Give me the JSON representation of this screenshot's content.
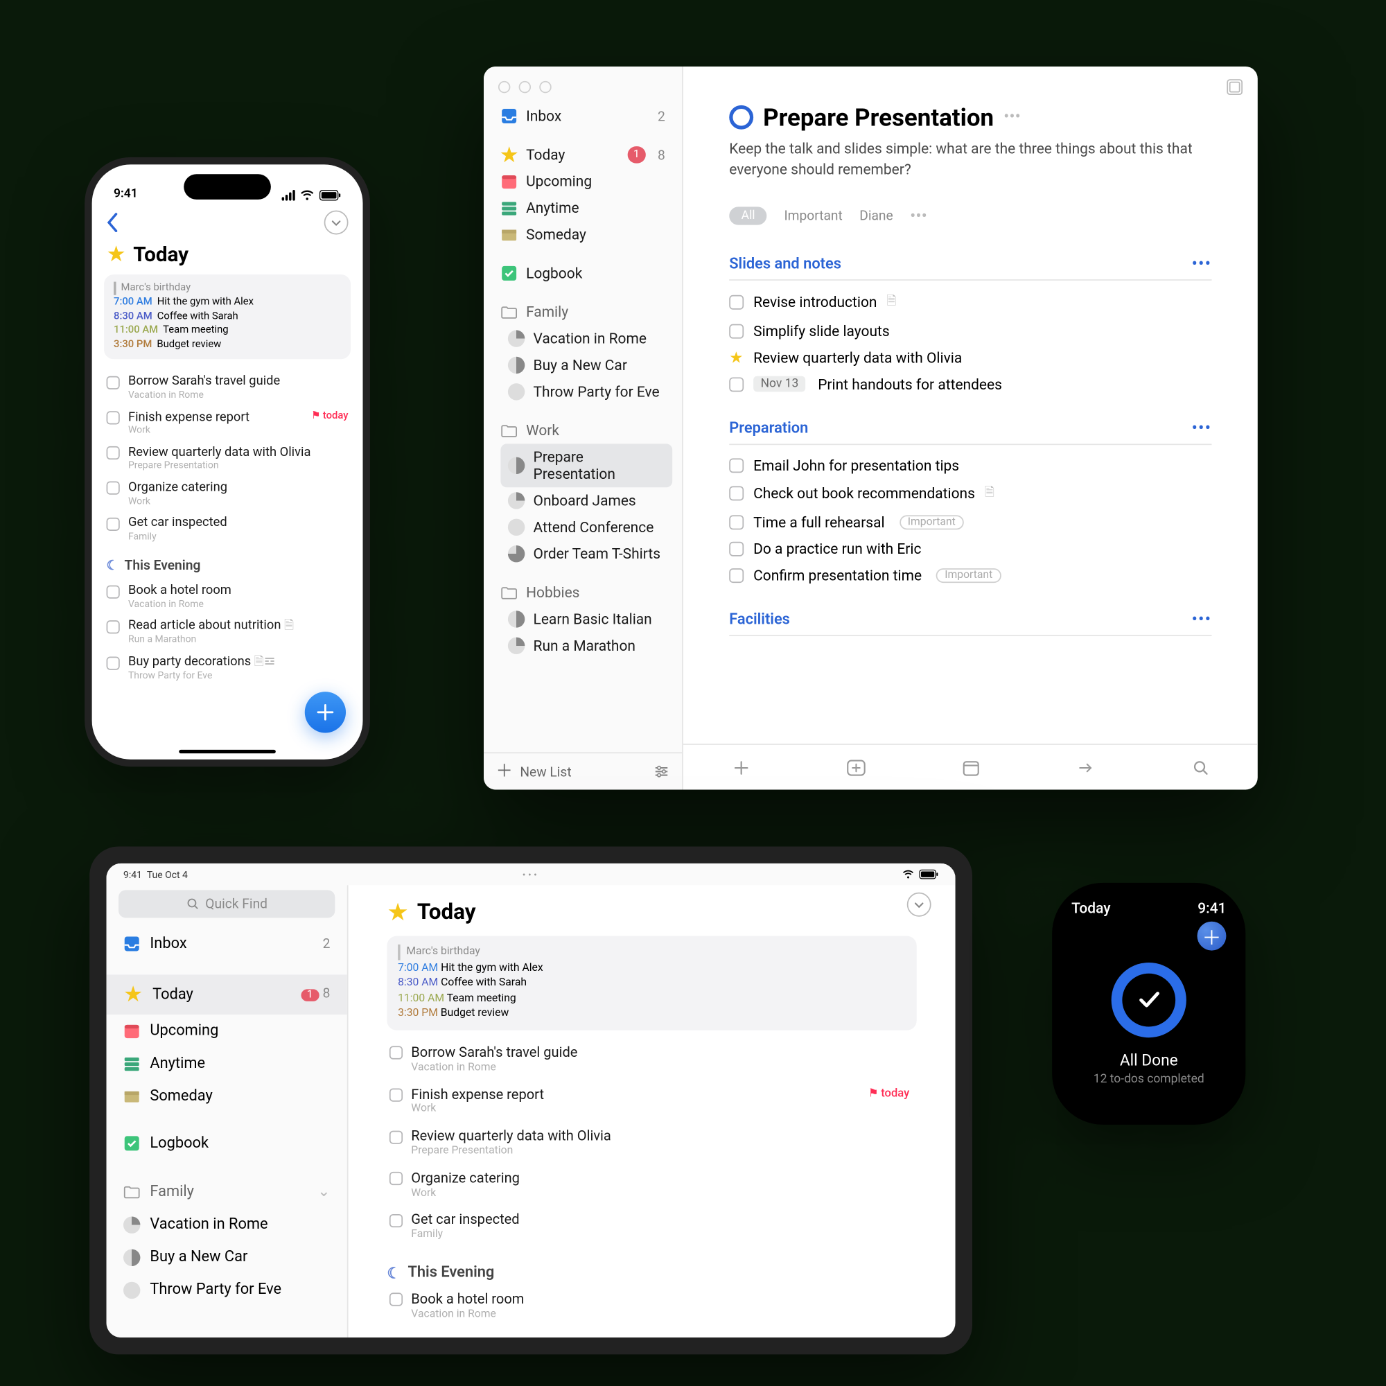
{
  "iphone": {
    "time": "9:41",
    "title": "Today",
    "events": {
      "birthday": "Marc's birthday",
      "items": [
        {
          "time": "7:00 AM",
          "text": "Hit the gym with Alex",
          "cls": "c-blue"
        },
        {
          "time": "8:30 AM",
          "text": "Coffee with Sarah",
          "cls": "c-indigo"
        },
        {
          "time": "11:00 AM",
          "text": "Team meeting",
          "cls": "c-olive"
        },
        {
          "time": "3:30 PM",
          "text": "Budget review",
          "cls": "c-brown"
        }
      ]
    },
    "tasks": [
      {
        "title": "Borrow Sarah's travel guide",
        "sub": "Vacation in Rome"
      },
      {
        "title": "Finish expense report",
        "sub": "Work",
        "flag": "today"
      },
      {
        "title": "Review quarterly data with Olivia",
        "sub": "Prepare Presentation"
      },
      {
        "title": "Organize catering",
        "sub": "Work"
      },
      {
        "title": "Get car inspected",
        "sub": "Family"
      }
    ],
    "evening_label": "This Evening",
    "evening_tasks": [
      {
        "title": "Book a hotel room",
        "sub": "Vacation in Rome"
      },
      {
        "title": "Read article about nutrition",
        "sub": "Run a Marathon",
        "note": true
      },
      {
        "title": "Buy party decorations",
        "sub": "Throw Party for Eve",
        "note": true,
        "list": true
      }
    ]
  },
  "mac": {
    "sidebar": {
      "inbox": {
        "label": "Inbox",
        "count": "2"
      },
      "today": {
        "label": "Today",
        "badge": "1",
        "count": "8"
      },
      "upcoming": {
        "label": "Upcoming"
      },
      "anytime": {
        "label": "Anytime"
      },
      "someday": {
        "label": "Someday"
      },
      "logbook": {
        "label": "Logbook"
      },
      "family": {
        "label": "Family",
        "items": [
          "Vacation in Rome",
          "Buy a New Car",
          "Throw Party for Eve"
        ]
      },
      "work": {
        "label": "Work",
        "items": [
          "Prepare Presentation",
          "Onboard James",
          "Attend Conference",
          "Order Team T-Shirts"
        ]
      },
      "hobbies": {
        "label": "Hobbies",
        "items": [
          "Learn Basic Italian",
          "Run a Marathon"
        ]
      },
      "new_list": "New List"
    },
    "main": {
      "title": "Prepare Presentation",
      "notes": "Keep the talk and slides simple: what are the three things about this that everyone should remember?",
      "tags": {
        "all": "All",
        "important": "Important",
        "diane": "Diane"
      },
      "groups": [
        {
          "name": "Slides and notes",
          "tasks": [
            {
              "t": "Revise introduction",
              "note": true
            },
            {
              "t": "Simplify slide layouts"
            },
            {
              "t": "Review quarterly data with Olivia",
              "star": true
            },
            {
              "t": "Print handouts for attendees",
              "date": "Nov 13"
            }
          ]
        },
        {
          "name": "Preparation",
          "tasks": [
            {
              "t": "Email John for presentation tips"
            },
            {
              "t": "Check out book recommendations",
              "note": true
            },
            {
              "t": "Time a full rehearsal",
              "imp": "Important"
            },
            {
              "t": "Do a practice run with Eric"
            },
            {
              "t": "Confirm presentation time",
              "imp": "Important"
            }
          ]
        },
        {
          "name": "Facilities",
          "tasks": []
        }
      ]
    }
  },
  "ipad": {
    "time": "9:41",
    "date": "Tue Oct 4",
    "quick_find": "Quick Find",
    "sidebar": {
      "inbox": {
        "label": "Inbox",
        "count": "2"
      },
      "today": {
        "label": "Today",
        "badge": "1",
        "count": "8"
      },
      "upcoming": "Upcoming",
      "anytime": "Anytime",
      "someday": "Someday",
      "logbook": "Logbook",
      "family": {
        "label": "Family",
        "items": [
          "Vacation in Rome",
          "Buy a New Car",
          "Throw Party for Eve"
        ]
      }
    },
    "title": "Today",
    "events": {
      "birthday": "Marc's birthday",
      "items": [
        {
          "time": "7:00 AM",
          "text": "Hit the gym with Alex",
          "cls": "c-blue"
        },
        {
          "time": "8:30 AM",
          "text": "Coffee with Sarah",
          "cls": "c-indigo"
        },
        {
          "time": "11:00 AM",
          "text": "Team meeting",
          "cls": "c-olive"
        },
        {
          "time": "3:30 PM",
          "text": "Budget review",
          "cls": "c-brown"
        }
      ]
    },
    "tasks": [
      {
        "title": "Borrow Sarah's travel guide",
        "sub": "Vacation in Rome"
      },
      {
        "title": "Finish expense report",
        "sub": "Work",
        "flag": "today"
      },
      {
        "title": "Review quarterly data with Olivia",
        "sub": "Prepare Presentation"
      },
      {
        "title": "Organize catering",
        "sub": "Work"
      },
      {
        "title": "Get car inspected",
        "sub": "Family"
      }
    ],
    "evening_label": "This Evening",
    "evening_tasks": [
      {
        "title": "Book a hotel room",
        "sub": "Vacation in Rome"
      }
    ]
  },
  "watch": {
    "title": "Today",
    "time": "9:41",
    "line1": "All Done",
    "line2": "12 to-dos completed"
  }
}
